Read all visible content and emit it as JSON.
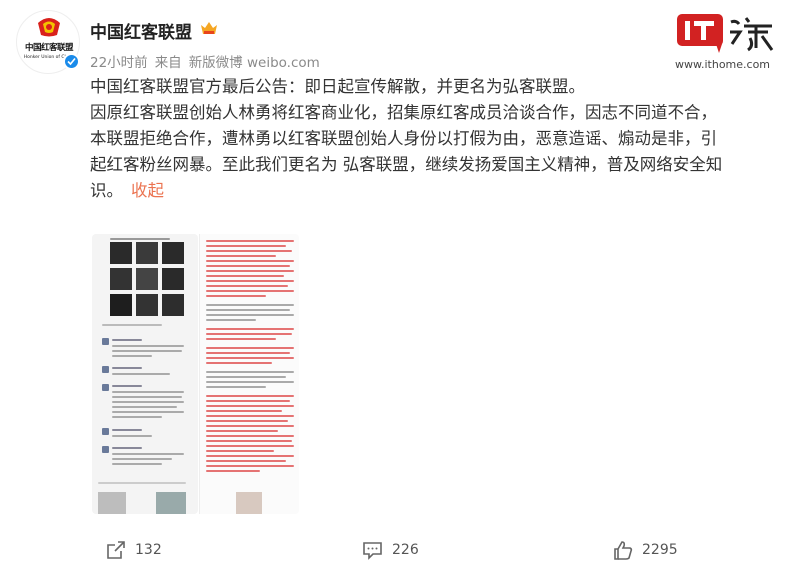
{
  "author": {
    "name": "中国红客联盟",
    "avatar_text": "中国红客联盟",
    "avatar_subtext": "Honker Union of China",
    "verified": true,
    "brand_color": "#d9211c"
  },
  "meta": {
    "time": "22小时前",
    "source_prefix": "来自",
    "source": "新版微博 weibo.com"
  },
  "watermark": {
    "logo": "IT之家",
    "url": "www.ithome.com"
  },
  "post": {
    "lines": [
      "中国红客联盟官方最后公告：即日起宣传解散，并更名为弘客联盟。",
      "因原红客联盟创始人林勇将红客商业化，招集原红客成员洽谈合作，因志不同道不合，",
      "本联盟拒绝合作，遭林勇以红客联盟创始人身份以打假为由，恶意造谣、煽动是非，引",
      "起红客粉丝网暴。至此我们更名为 弘客联盟，继续发扬爱国主义精神，普及网络安全知",
      "识。"
    ],
    "collapse_label": "收起"
  },
  "images": [
    {
      "icon": "chat-screenshot-image"
    },
    {
      "icon": "announcement-document-image"
    }
  ],
  "actions": {
    "share": {
      "icon": "share-icon",
      "count": "132"
    },
    "comment": {
      "icon": "comment-icon",
      "count": "226"
    },
    "like": {
      "icon": "like-icon",
      "count": "2295"
    }
  }
}
